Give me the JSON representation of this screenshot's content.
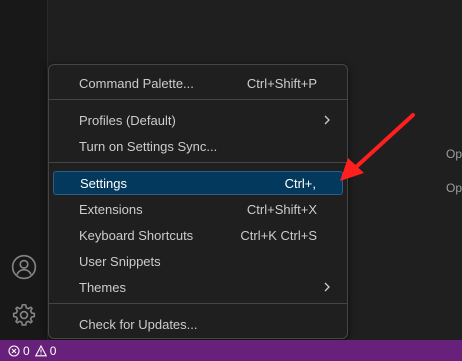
{
  "activity_bar": {
    "icons": [
      {
        "name": "account-icon"
      },
      {
        "name": "manage-gear-icon"
      }
    ]
  },
  "editor": {
    "peek_texts": [
      "Op",
      "Op"
    ]
  },
  "menu": {
    "items": [
      {
        "label": "Command Palette...",
        "shortcut": "Ctrl+Shift+P",
        "submenu": false
      },
      {
        "label": "Profiles (Default)",
        "shortcut": "",
        "submenu": true
      },
      {
        "label": "Turn on Settings Sync...",
        "shortcut": "",
        "submenu": false
      },
      {
        "label": "Settings",
        "shortcut": "Ctrl+,",
        "submenu": false,
        "active": true
      },
      {
        "label": "Extensions",
        "shortcut": "Ctrl+Shift+X",
        "submenu": false
      },
      {
        "label": "Keyboard Shortcuts",
        "shortcut": "Ctrl+K Ctrl+S",
        "submenu": false
      },
      {
        "label": "User Snippets",
        "shortcut": "",
        "submenu": false
      },
      {
        "label": "Themes",
        "shortcut": "",
        "submenu": true
      },
      {
        "label": "Check for Updates...",
        "shortcut": "",
        "submenu": false
      }
    ]
  },
  "status_bar": {
    "errors": "0",
    "warnings": "0"
  },
  "colors": {
    "status_bar": "#68217a",
    "menu_active": "#04395e",
    "annotation_arrow": "#ff1f1f"
  }
}
